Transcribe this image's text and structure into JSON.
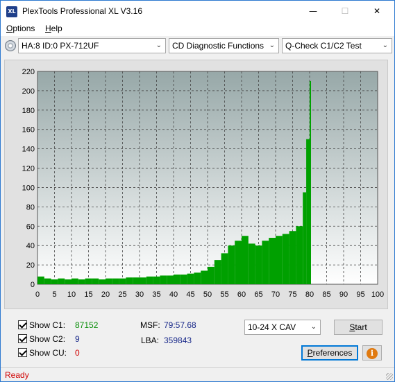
{
  "window": {
    "title": "PlexTools Professional XL V3.16",
    "icon_text": "XL",
    "minimize_glyph": "—",
    "maximize_glyph": "☐",
    "close_glyph": "✕"
  },
  "menu": {
    "options_first": "O",
    "options_rest": "ptions",
    "help_first": "H",
    "help_rest": "elp"
  },
  "toolbar": {
    "drive_icon": "cd-drive-icon",
    "drive_select": "HA:8 ID:0  PX-712UF",
    "function_select": "CD Diagnostic Functions",
    "test_select": "Q-Check C1/C2 Test",
    "dropdown_glyph": "⌄"
  },
  "panel": {
    "show_c1_label": "Show C1:",
    "show_c1_value": "87152",
    "show_c2_label": "Show C2:",
    "show_c2_value": "9",
    "show_cu_label": "Show CU:",
    "show_cu_value": "0",
    "msf_label": "MSF:",
    "msf_value": "79:57.68",
    "lba_label": "LBA:",
    "lba_value": "359843",
    "speed_select": "10-24 X CAV",
    "start_first": "S",
    "start_rest": "tart",
    "preferences_first": "P",
    "preferences_rest": "references",
    "info_glyph": "i",
    "colors": {
      "c1": "#0a8f0a",
      "c2": "#1a2a8a",
      "cu": "#d00000"
    }
  },
  "status": {
    "text": "Ready"
  },
  "chart_data": {
    "type": "bar",
    "xlim": [
      0,
      100
    ],
    "ylim": [
      0,
      220
    ],
    "x_ticks": [
      0,
      5,
      10,
      15,
      20,
      25,
      30,
      35,
      40,
      45,
      50,
      55,
      60,
      65,
      70,
      75,
      80,
      85,
      90,
      95,
      100
    ],
    "y_ticks": [
      0,
      20,
      40,
      60,
      80,
      100,
      120,
      140,
      160,
      180,
      200,
      220
    ],
    "grid": true,
    "series": [
      {
        "color": "#00a000",
        "x": [
          0,
          2,
          4,
          6,
          8,
          10,
          12,
          14,
          16,
          18,
          20,
          22,
          24,
          26,
          28,
          30,
          32,
          34,
          36,
          38,
          40,
          42,
          44,
          46,
          48,
          50,
          52,
          54,
          56,
          58,
          60,
          62,
          64,
          66,
          68,
          70,
          72,
          74,
          76,
          78,
          79,
          80
        ],
        "y": [
          8,
          6,
          5,
          6,
          5,
          6,
          5,
          6,
          6,
          5,
          6,
          6,
          6,
          7,
          7,
          7,
          8,
          8,
          9,
          9,
          10,
          10,
          11,
          12,
          14,
          18,
          25,
          32,
          40,
          45,
          50,
          42,
          40,
          45,
          48,
          50,
          52,
          55,
          60,
          95,
          150,
          210
        ]
      }
    ]
  }
}
